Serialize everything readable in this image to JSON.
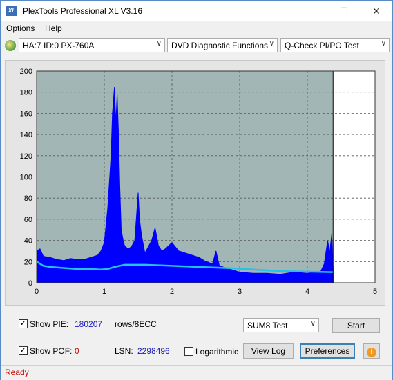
{
  "window": {
    "title": "PlexTools Professional XL V3.16",
    "app_icon": "XL"
  },
  "menu": {
    "options": "Options",
    "help": "Help"
  },
  "toolbar": {
    "drive": "HA:7 ID:0  PX-760A",
    "function": "DVD Diagnostic Functions",
    "test": "Q-Check PI/PO Test"
  },
  "chart_data": {
    "type": "area",
    "x_ticks": [
      "0",
      "1",
      "2",
      "3",
      "4",
      "5"
    ],
    "y_ticks": [
      "0",
      "20",
      "40",
      "60",
      "80",
      "100",
      "120",
      "140",
      "160",
      "180",
      "200"
    ],
    "xlim": [
      0,
      5
    ],
    "ylim": [
      0,
      200
    ],
    "grid": true,
    "end_marker_x": 4.38,
    "series": [
      {
        "color": "#0000ff",
        "x": [
          0,
          0.05,
          0.1,
          0.2,
          0.3,
          0.4,
          0.5,
          0.6,
          0.7,
          0.8,
          0.9,
          0.95,
          1.0,
          1.05,
          1.1,
          1.12,
          1.15,
          1.17,
          1.19,
          1.21,
          1.23,
          1.25,
          1.28,
          1.3,
          1.35,
          1.4,
          1.45,
          1.5,
          1.52,
          1.55,
          1.6,
          1.7,
          1.75,
          1.8,
          1.85,
          1.9,
          2.0,
          2.1,
          2.2,
          2.3,
          2.4,
          2.5,
          2.6,
          2.65,
          2.7,
          2.8,
          2.9,
          3.0,
          3.2,
          3.4,
          3.6,
          3.8,
          4.0,
          4.1,
          4.2,
          4.25,
          4.3,
          4.33,
          4.36,
          4.38
        ],
        "values": [
          30,
          32,
          25,
          24,
          22,
          21,
          23,
          22,
          22,
          24,
          26,
          30,
          38,
          70,
          120,
          160,
          185,
          150,
          178,
          140,
          90,
          50,
          40,
          35,
          32,
          34,
          40,
          85,
          60,
          45,
          28,
          40,
          52,
          35,
          30,
          32,
          38,
          30,
          28,
          26,
          24,
          20,
          18,
          30,
          16,
          14,
          12,
          10,
          9,
          9,
          8,
          10,
          9,
          10,
          11,
          18,
          40,
          28,
          46,
          14
        ]
      },
      {
        "color": "#22c3e6",
        "x": [
          0,
          0.1,
          0.2,
          0.4,
          0.6,
          0.8,
          0.95,
          1.05,
          1.15,
          1.3,
          1.6,
          2.0,
          2.4,
          2.8,
          3.2,
          3.6,
          4.0,
          4.38
        ],
        "values": [
          20,
          16,
          15,
          14,
          13,
          13,
          12.5,
          13,
          15,
          17,
          17,
          16,
          15,
          14,
          12.5,
          11,
          10.5,
          10
        ]
      }
    ]
  },
  "controls": {
    "show_pie_label": "Show PIE:",
    "pie_value": "180207",
    "rows_label": "rows/8ECC",
    "show_poe_label": "Show POF:",
    "poe_value": "0",
    "lsn_label": "LSN:",
    "lsn_value": "2298496",
    "logarithmic_label": "Logarithmic",
    "test_mode": "SUM8 Test",
    "start_button": "Start",
    "view_log_button": "View Log",
    "preferences_button": "Preferences"
  },
  "status": {
    "text": "Ready"
  },
  "colors": {
    "pie_value": "#1a1ab8",
    "poe_value": "#cc0000",
    "status_text": "#cc0000",
    "chart_bg": "#a3b6b6",
    "pi_series": "#0000ff",
    "avg_line": "#22c3e6"
  }
}
